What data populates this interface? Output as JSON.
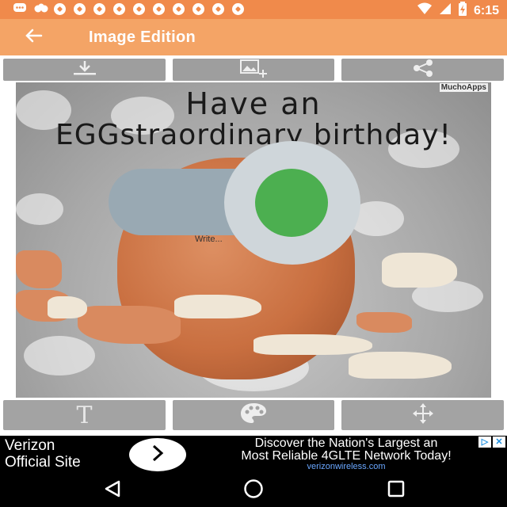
{
  "status_bar": {
    "time": "6:15",
    "notification_icons": [
      "messenger-icon",
      "community-icon",
      "soccer-ball-icon",
      "soccer-ball-icon",
      "soccer-ball-icon",
      "soccer-ball-icon",
      "soccer-ball-icon",
      "soccer-ball-icon",
      "soccer-ball-icon",
      "soccer-ball-icon",
      "soccer-ball-icon",
      "soccer-ball-icon"
    ],
    "system_icons": [
      "wifi-icon",
      "signal-icon",
      "battery-charging-icon"
    ]
  },
  "app_bar": {
    "title": "Image Edition",
    "back_icon": "arrow-left-icon",
    "color": "#f4a466"
  },
  "top_toolbar": {
    "buttons": [
      {
        "icon": "download-icon"
      },
      {
        "icon": "add-image-icon"
      },
      {
        "icon": "share-icon"
      }
    ]
  },
  "card": {
    "title_line1": "Have an",
    "title_line2": "EGGstraordinary birthday!",
    "watermark": "MuchoApps",
    "text_hint": "Write..."
  },
  "toggle": {
    "state": "on",
    "thumb_color": "#4caf50",
    "track_color": "#99a9b3"
  },
  "bottom_toolbar": {
    "buttons": [
      {
        "icon": "text-icon",
        "label": "T"
      },
      {
        "icon": "palette-icon"
      },
      {
        "icon": "move-icon"
      }
    ]
  },
  "ad": {
    "brand_line1": "Verizon",
    "brand_line2": "Official Site",
    "headline_line1": "Discover the Nation's Largest an",
    "headline_line2": "Most Reliable 4GLTE Network Today!",
    "url": "verizonwireless.com"
  },
  "nav_bar": {
    "buttons": [
      "back-triangle-icon",
      "home-circle-icon",
      "recents-square-icon"
    ]
  }
}
